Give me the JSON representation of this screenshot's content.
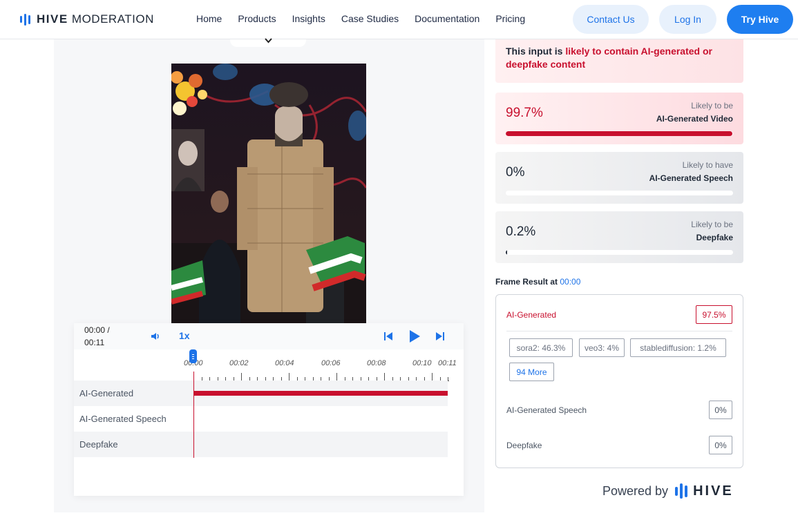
{
  "brand": {
    "strong": "HIVE",
    "rest": "MODERATION"
  },
  "nav": {
    "links": [
      "Home",
      "Products",
      "Insights",
      "Case Studies",
      "Documentation",
      "Pricing"
    ],
    "contact": "Contact Us",
    "login": "Log In",
    "try": "Try Hive"
  },
  "player": {
    "current_time": "00:00 /",
    "duration": "00:11",
    "speed": "1x",
    "tick_labels": [
      "00:00",
      "00:02",
      "00:04",
      "00:06",
      "00:08",
      "00:10",
      "00:11"
    ],
    "tracks": [
      {
        "label": "AI-Generated",
        "detected_fraction": 1.0
      },
      {
        "label": "AI-Generated Speech",
        "detected_fraction": 0
      },
      {
        "label": "Deepfake",
        "detected_fraction": 0
      }
    ]
  },
  "verdict": {
    "prefix": "This input is ",
    "highlight": "likely to contain AI-generated or deepfake content"
  },
  "scores": [
    {
      "pct": "99.7%",
      "cap1": "Likely to be",
      "cap2": "AI-Generated Video",
      "value": 99.7,
      "style": "red"
    },
    {
      "pct": "0%",
      "cap1": "Likely to have",
      "cap2": "AI-Generated Speech",
      "value": 0,
      "style": "grey"
    },
    {
      "pct": "0.2%",
      "cap1": "Likely to be",
      "cap2": "Deepfake",
      "value": 0.2,
      "style": "grey"
    }
  ],
  "frame_result": {
    "title": "Frame Result at ",
    "time": "00:00",
    "ai_generated": {
      "label": "AI-Generated",
      "score": "97.5%"
    },
    "chips": [
      "sora2: 46.3%",
      "veo3: 4%",
      "stablediffusion: 1.2%"
    ],
    "more": "94 More",
    "speech": {
      "label": "AI-Generated Speech",
      "score": "0%"
    },
    "deepfake": {
      "label": "Deepfake",
      "score": "0%"
    }
  },
  "powered": {
    "text": "Powered by",
    "name": "HIVE"
  },
  "colors": {
    "accent": "#1e73e8",
    "danger": "#c8102e"
  },
  "icons": [
    "chevron-down-icon",
    "volume-icon",
    "skip-back-icon",
    "play-icon",
    "skip-forward-icon"
  ]
}
